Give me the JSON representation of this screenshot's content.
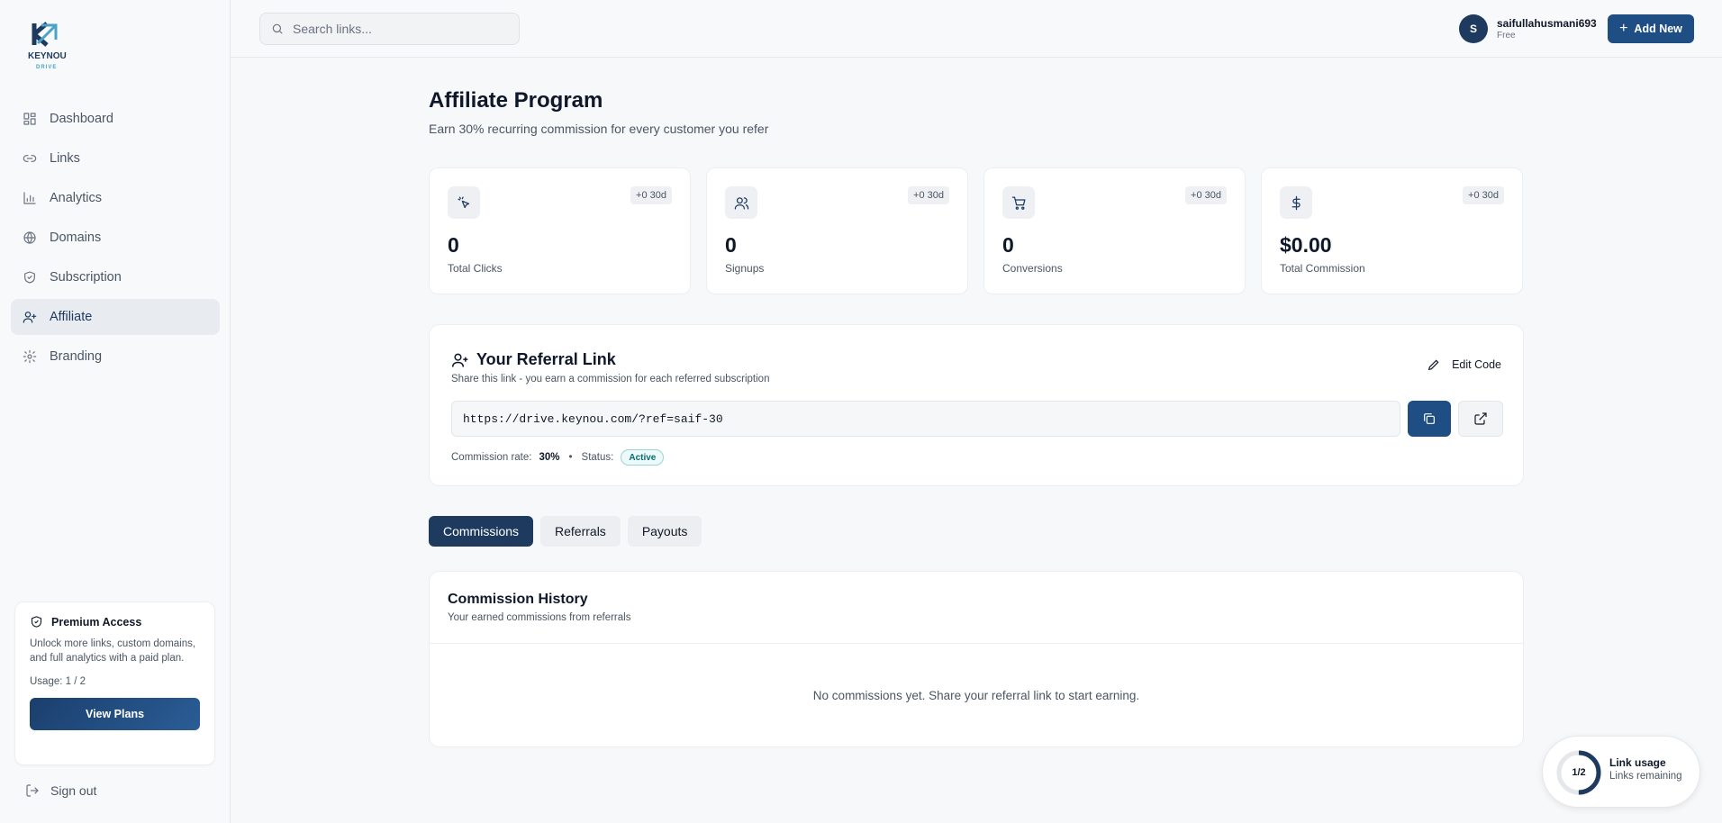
{
  "brand": {
    "logo_text": "KEYNOU",
    "logo_sub": "DRIVE"
  },
  "sidebar": {
    "items": [
      {
        "label": "Dashboard",
        "icon": "grid-icon"
      },
      {
        "label": "Links",
        "icon": "link-icon"
      },
      {
        "label": "Analytics",
        "icon": "bar-chart-icon"
      },
      {
        "label": "Domains",
        "icon": "globe-icon"
      },
      {
        "label": "Subscription",
        "icon": "shield-icon"
      },
      {
        "label": "Affiliate",
        "icon": "user-plus-icon",
        "active": true
      },
      {
        "label": "Branding",
        "icon": "gear-icon"
      }
    ],
    "premium": {
      "title": "Premium Access",
      "description": "Unlock more links, custom domains, and full analytics with a paid plan.",
      "usage": "Usage: 1 / 2",
      "button": "View Plans"
    },
    "signout": "Sign out"
  },
  "topbar": {
    "search_placeholder": "Search links...",
    "user": {
      "initial": "S",
      "name": "saifullahusmani693",
      "plan": "Free"
    },
    "add_new": "Add New"
  },
  "page": {
    "title": "Affiliate Program",
    "subtitle": "Earn 30% recurring commission for every customer you refer"
  },
  "stats": [
    {
      "icon": "cursor-click-icon",
      "chip": "+0 30d",
      "value": "0",
      "label": "Total Clicks"
    },
    {
      "icon": "users-icon",
      "chip": "+0 30d",
      "value": "0",
      "label": "Signups"
    },
    {
      "icon": "cart-icon",
      "chip": "+0 30d",
      "value": "0",
      "label": "Conversions"
    },
    {
      "icon": "dollar-icon",
      "chip": "+0 30d",
      "value": "$0.00",
      "label": "Total Commission"
    }
  ],
  "referral": {
    "title": "Your Referral Link",
    "subtitle": "Share this link - you earn a commission for each referred subscription",
    "edit_code": "Edit Code",
    "link": "https://drive.keynou.com/?ref=saif-30",
    "rate_label": "Commission rate:",
    "rate_value": "30%",
    "dot": "•",
    "status_label": "Status:",
    "status_value": "Active"
  },
  "tabs": [
    {
      "label": "Commissions",
      "active": true
    },
    {
      "label": "Referrals"
    },
    {
      "label": "Payouts"
    }
  ],
  "history": {
    "title": "Commission History",
    "subtitle": "Your earned commissions from referrals",
    "empty": "No commissions yet. Share your referral link to start earning."
  },
  "usage_widget": {
    "count": "1/2",
    "fraction": 0.5,
    "title": "Link usage",
    "subtitle": "Links remaining"
  },
  "colors": {
    "primary": "#1e3a5f",
    "accent": "#1f4e85",
    "active_badge": "#0b6b73"
  }
}
